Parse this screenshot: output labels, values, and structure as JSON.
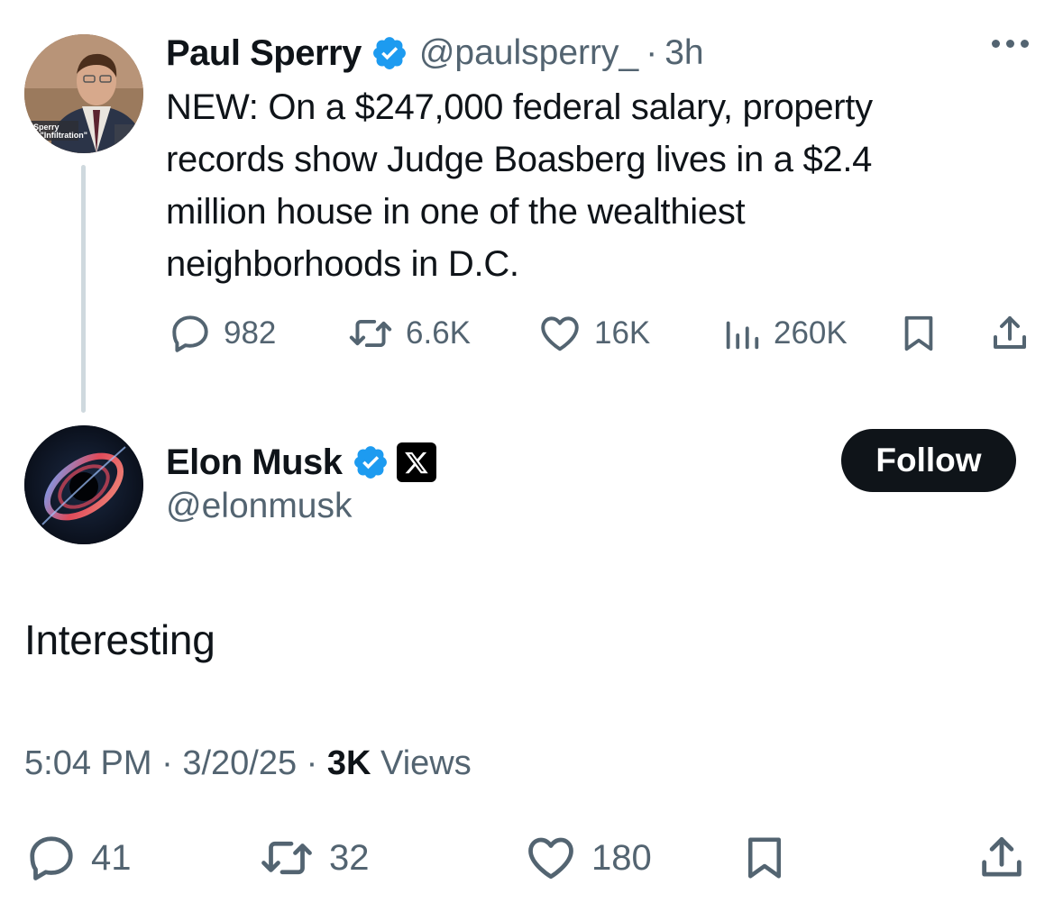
{
  "parent_tweet": {
    "author_name": "Paul Sperry",
    "handle": "@paulsperry_",
    "separator": "·",
    "time_ago": "3h",
    "avatar_caption_1": "Sperry",
    "avatar_caption_2": "or, \"Infiltration\"",
    "text_lines": [
      "NEW: On a $247,000 federal salary, property",
      "records show Judge Boasberg lives in a $2.4",
      "million house in one of the wealthiest",
      "neighborhoods in D.C."
    ],
    "stats": {
      "replies": "982",
      "reposts": "6.6K",
      "likes": "16K",
      "views": "260K"
    },
    "icons": [
      "verified-badge-icon",
      "more-icon",
      "reply-icon",
      "repost-icon",
      "like-icon",
      "views-icon",
      "bookmark-icon",
      "share-icon"
    ]
  },
  "reply_tweet": {
    "author_name": "Elon Musk",
    "handle": "@elonmusk",
    "follow_label": "Follow",
    "text": "Interesting",
    "meta": {
      "time": "5:04 PM",
      "separator": "·",
      "date": "3/20/25",
      "views_count": "3K",
      "views_label": "Views"
    },
    "stats": {
      "replies": "41",
      "reposts": "32",
      "likes": "180"
    },
    "icons": [
      "verified-badge-icon",
      "x-logo-icon",
      "reply-icon",
      "repost-icon",
      "like-icon",
      "bookmark-icon",
      "share-icon"
    ]
  },
  "colors": {
    "text_primary": "#0f1419",
    "text_secondary": "#536471",
    "verified_blue": "#1d9bf0",
    "thread_line": "#cfd9de",
    "follow_bg": "#0f1419"
  }
}
